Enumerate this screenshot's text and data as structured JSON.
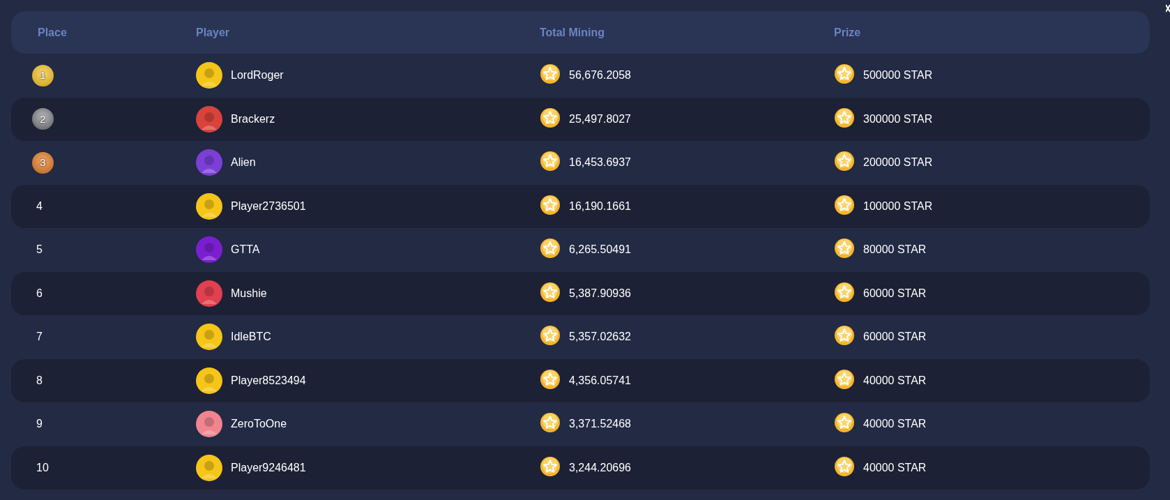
{
  "table": {
    "columns": [
      "Place",
      "Player",
      "Total Mining",
      "Prize"
    ],
    "rows": [
      {
        "place": "1",
        "kind": "gold",
        "player": "LordRoger",
        "color": "#f5c518",
        "total_mining": "56,676.2058",
        "prize": "500000 STAR"
      },
      {
        "place": "2",
        "kind": "silver",
        "player": "Brackerz",
        "color": "#d8433b",
        "total_mining": "25,497.8027",
        "prize": "300000 STAR"
      },
      {
        "place": "3",
        "kind": "bronze",
        "player": "Alien",
        "color": "#7b3fd6",
        "total_mining": "16,453.6937",
        "prize": "200000 STAR"
      },
      {
        "place": "4",
        "kind": "plain",
        "player": "Player2736501",
        "color": "#f5c518",
        "total_mining": "16,190.1661",
        "prize": "100000 STAR"
      },
      {
        "place": "5",
        "kind": "plain",
        "player": "GTTA",
        "color": "#7a1fd0",
        "total_mining": "6,265.50491",
        "prize": "80000 STAR"
      },
      {
        "place": "6",
        "kind": "plain",
        "player": "Mushie",
        "color": "#e0404f",
        "total_mining": "5,387.90936",
        "prize": "60000 STAR"
      },
      {
        "place": "7",
        "kind": "plain",
        "player": "IdleBTC",
        "color": "#f5c518",
        "total_mining": "5,357.02632",
        "prize": "60000 STAR"
      },
      {
        "place": "8",
        "kind": "plain",
        "player": "Player8523494",
        "color": "#f5c518",
        "total_mining": "4,356.05741",
        "prize": "40000 STAR"
      },
      {
        "place": "9",
        "kind": "plain",
        "player": "ZeroToOne",
        "color": "#f0858f",
        "total_mining": "3,371.52468",
        "prize": "40000 STAR"
      },
      {
        "place": "10",
        "kind": "plain",
        "player": "Player9246481",
        "color": "#f5c518",
        "total_mining": "3,244.20696",
        "prize": "40000 STAR"
      }
    ]
  }
}
